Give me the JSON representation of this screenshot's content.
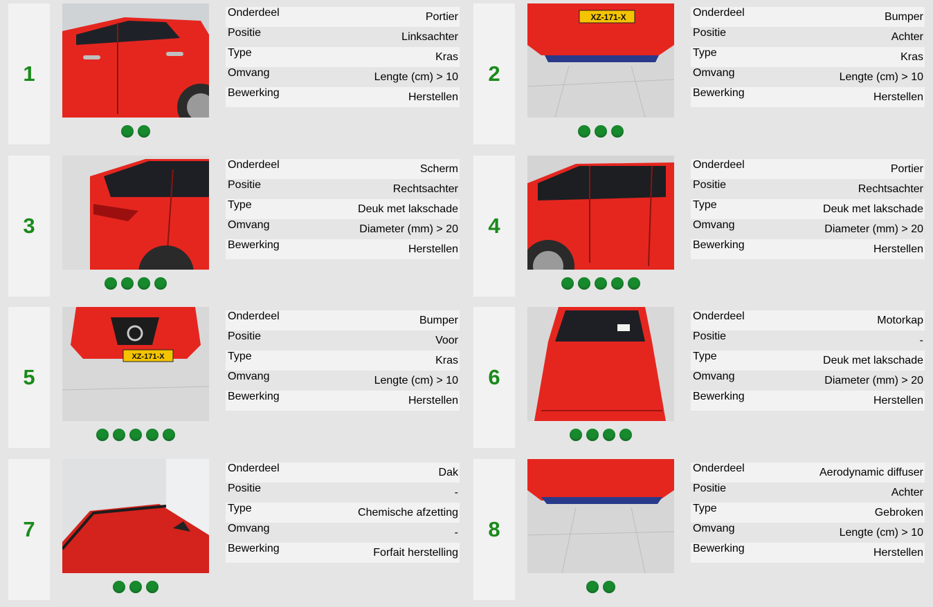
{
  "labels": {
    "onderdeel": "Onderdeel",
    "positie": "Positie",
    "type": "Type",
    "omvang": "Omvang",
    "bewerking": "Bewerking"
  },
  "colors": {
    "number": "#1a8a1a",
    "dot": "#188a2e",
    "background": "#e5e5e5",
    "stripe": "#f2f2f2"
  },
  "damages": [
    {
      "number": "1",
      "onderdeel": "Portier",
      "positie": "Linksachter",
      "type": "Kras",
      "omvang": "Lengte (cm) > 10",
      "bewerking": "Herstellen",
      "dots": 2
    },
    {
      "number": "2",
      "onderdeel": "Bumper",
      "positie": "Achter",
      "type": "Kras",
      "omvang": "Lengte (cm) > 10",
      "bewerking": "Herstellen",
      "dots": 3,
      "plate": "XZ-171-X"
    },
    {
      "number": "3",
      "onderdeel": "Scherm",
      "positie": "Rechtsachter",
      "type": "Deuk met lakschade",
      "omvang": "Diameter (mm) > 20",
      "bewerking": "Herstellen",
      "dots": 4
    },
    {
      "number": "4",
      "onderdeel": "Portier",
      "positie": "Rechtsachter",
      "type": "Deuk met lakschade",
      "omvang": "Diameter (mm) > 20",
      "bewerking": "Herstellen",
      "dots": 5
    },
    {
      "number": "5",
      "onderdeel": "Bumper",
      "positie": "Voor",
      "type": "Kras",
      "omvang": "Lengte (cm) > 10",
      "bewerking": "Herstellen",
      "dots": 5,
      "plate": "XZ-171-X"
    },
    {
      "number": "6",
      "onderdeel": "Motorkap",
      "positie": "-",
      "type": "Deuk met lakschade",
      "omvang": "Diameter (mm) > 20",
      "bewerking": "Herstellen",
      "dots": 4
    },
    {
      "number": "7",
      "onderdeel": "Dak",
      "positie": "-",
      "type": "Chemische afzetting",
      "omvang": "-",
      "bewerking": "Forfait herstelling",
      "dots": 3
    },
    {
      "number": "8",
      "onderdeel": "Aerodynamic diffuser",
      "positie": "Achter",
      "type": "Gebroken",
      "omvang": "Lengte (cm) > 10",
      "bewerking": "Herstellen",
      "dots": 2
    }
  ]
}
